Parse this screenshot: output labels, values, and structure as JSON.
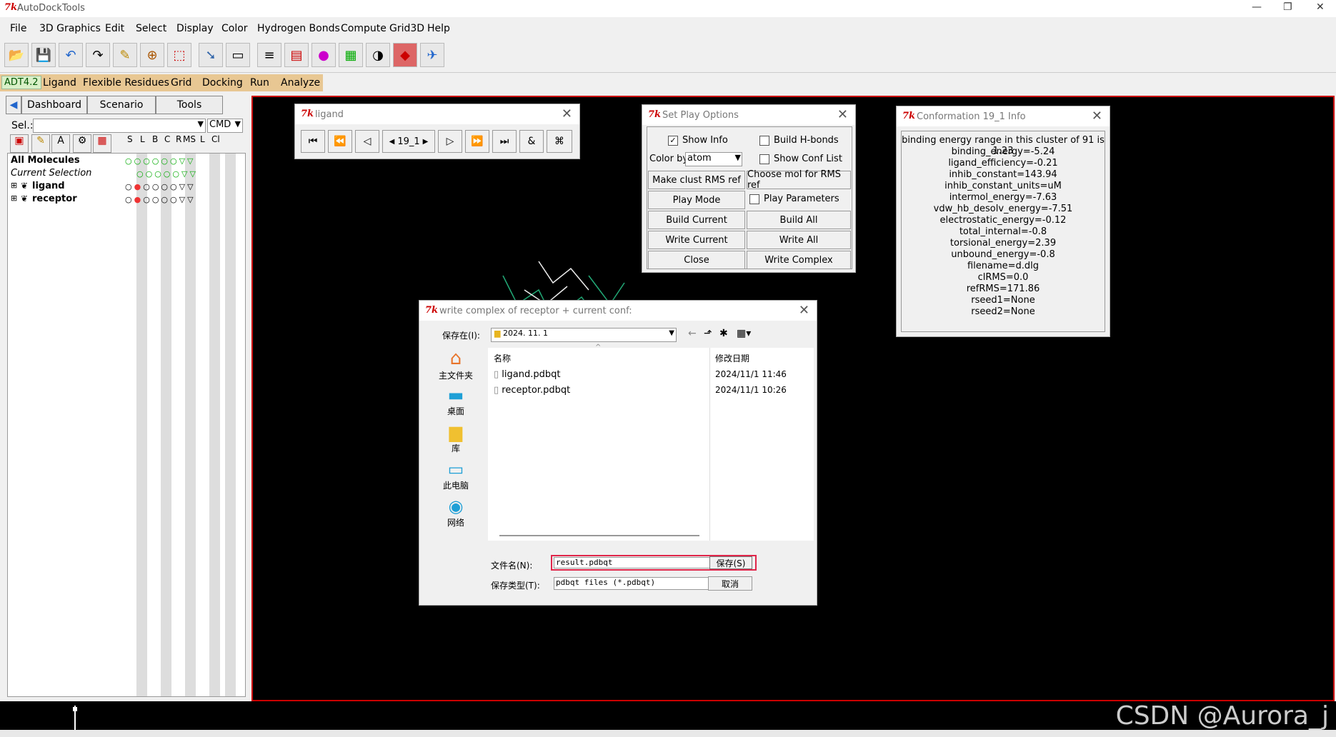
{
  "window": {
    "title": "AutoDockTools"
  },
  "menubar": [
    "File",
    "3D Graphics",
    "Edit",
    "Select",
    "Display",
    "Color",
    "Hydrogen Bonds",
    "Compute",
    "Grid3D",
    "Help"
  ],
  "cmdmenu": {
    "version": "ADT4.2",
    "items": [
      "Ligand",
      "Flexible Residues",
      "Grid",
      "Docking",
      "Run",
      "Analyze"
    ]
  },
  "left_tabs": [
    "Dashboard",
    "Scenario",
    "Tools"
  ],
  "sel": {
    "label": "Sel.:",
    "value": "",
    "cmd": "CMD"
  },
  "tree": {
    "col_headers": [
      "S",
      "L",
      "B",
      "C",
      "R",
      "MS",
      "L",
      "Cl"
    ],
    "nodes": [
      "All Molecules",
      "Current Selection",
      "ligand",
      "receptor"
    ]
  },
  "ligand_dlg": {
    "title": "ligand",
    "frame": "19_1"
  },
  "play_dlg": {
    "title": "Set Play Options",
    "show_info": "Show Info",
    "build_hbonds": "Build  H-bonds",
    "color_by_label": "Color by",
    "color_by_value": "atom",
    "show_conf_list": "Show Conf List",
    "make_clust": "Make clust RMS ref",
    "choose_mol": "Choose mol for RMS ref",
    "play_mode": "Play Mode",
    "play_params": "Play Parameters",
    "build_current": "Build Current",
    "build_all": "Build All",
    "write_current": "Write Current",
    "write_all": "Write All",
    "close": "Close",
    "write_complex": "Write Complex"
  },
  "info_dlg": {
    "title": "Conformation 19_1 Info",
    "lines": [
      "binding energy range in this cluster of 91 is 1.23",
      "binding_energy=-5.24",
      "ligand_efficiency=-0.21",
      "inhib_constant=143.94",
      "inhib_constant_units=uM",
      "intermol_energy=-7.63",
      "vdw_hb_desolv_energy=-7.51",
      "electrostatic_energy=-0.12",
      "total_internal=-0.8",
      "torsional_energy=2.39",
      "unbound_energy=-0.8",
      "filename=d.dlg",
      "clRMS=0.0",
      "refRMS=171.86",
      "rseed1=None",
      "rseed2=None"
    ]
  },
  "save_dlg": {
    "title": "write complex of receptor + current conf:",
    "save_in_label": "保存在(I):",
    "folder": "2024. 11. 1",
    "places": [
      "主文件夹",
      "桌面",
      "库",
      "此电脑",
      "网络"
    ],
    "col_name": "名称",
    "col_date": "修改日期",
    "files": [
      {
        "name": "ligand.pdbqt",
        "date": "2024/11/1 11:46"
      },
      {
        "name": "receptor.pdbqt",
        "date": "2024/11/1 10:26"
      }
    ],
    "filename_label": "文件名(N):",
    "filename_value": "result.pdbqt",
    "filetype_label": "保存类型(T):",
    "filetype_value": "pdbqt files (*.pdbqt)",
    "save_button": "保存(S)",
    "cancel_button": "取消"
  },
  "watermark": "CSDN @Aurora_j",
  "colors": {
    "accent_red": "#e0264a",
    "viewer_border": "#cc0000",
    "tk_red": "#cc0000",
    "cmdmenu": "#e8c793"
  }
}
